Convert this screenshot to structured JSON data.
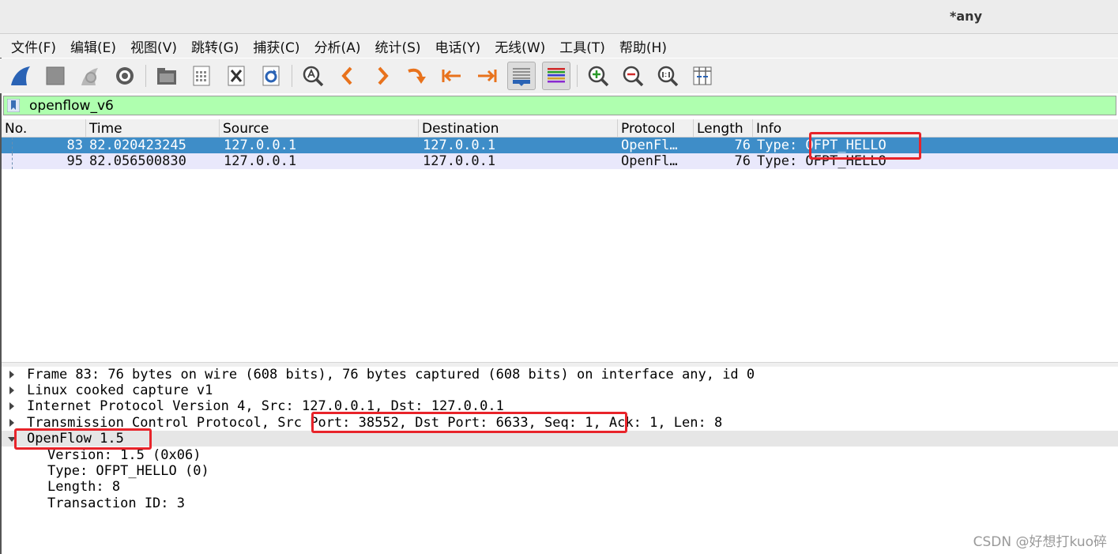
{
  "window": {
    "title": "*any"
  },
  "menu": [
    "文件(F)",
    "编辑(E)",
    "视图(V)",
    "跳转(G)",
    "捕获(C)",
    "分析(A)",
    "统计(S)",
    "电话(Y)",
    "无线(W)",
    "工具(T)",
    "帮助(H)"
  ],
  "toolbar": {
    "icons": [
      "shark-fin-start-icon",
      "stop-square-icon",
      "restart-capture-icon",
      "capture-options-gear-icon",
      "open-folder-icon",
      "save-file-icon",
      "close-file-icon",
      "reload-file-icon",
      "find-magnifier-icon",
      "back-arrow-icon",
      "forward-arrow-icon",
      "jump-to-packet-icon",
      "first-packet-icon",
      "last-packet-icon",
      "autoscroll-icon",
      "colorize-icon",
      "zoom-in-icon",
      "zoom-out-icon",
      "normal-size-icon",
      "resize-columns-icon"
    ]
  },
  "filter": {
    "value": "openflow_v6",
    "filter_bg": "#afffaf"
  },
  "packet_list": {
    "columns": [
      "No.",
      "Time",
      "Source",
      "Destination",
      "Protocol",
      "Length",
      "Info"
    ],
    "rows": [
      {
        "no": "83",
        "time": "82.020423245",
        "source": "127.0.0.1",
        "destination": "127.0.0.1",
        "protocol": "OpenFl…",
        "length": "76",
        "info": "Type: OFPT_HELLO"
      },
      {
        "no": "95",
        "time": "82.056500830",
        "source": "127.0.0.1",
        "destination": "127.0.0.1",
        "protocol": "OpenFl…",
        "length": "76",
        "info": "Type: OFPT_HELLO"
      }
    ],
    "selected_color": "#3e8dc8",
    "alt_color": "#e9e8fb"
  },
  "details": {
    "tree": [
      "Frame 83: 76 bytes on wire (608 bits), 76 bytes captured (608 bits) on interface any, id 0",
      "Linux cooked capture v1",
      "Internet Protocol Version 4, Src: 127.0.0.1, Dst: 127.0.0.1",
      "Transmission Control Protocol, Src Port: 38552, Dst Port: 6633, Seq: 1, Ack: 1, Len: 8",
      "OpenFlow 1.5"
    ],
    "children": [
      "Version: 1.5 (0x06)",
      "Type: OFPT_HELLO (0)",
      "Length: 8",
      "Transaction ID: 3"
    ]
  },
  "annotation_color": "#e8242a",
  "watermark": "CSDN @好想打kuo碎"
}
